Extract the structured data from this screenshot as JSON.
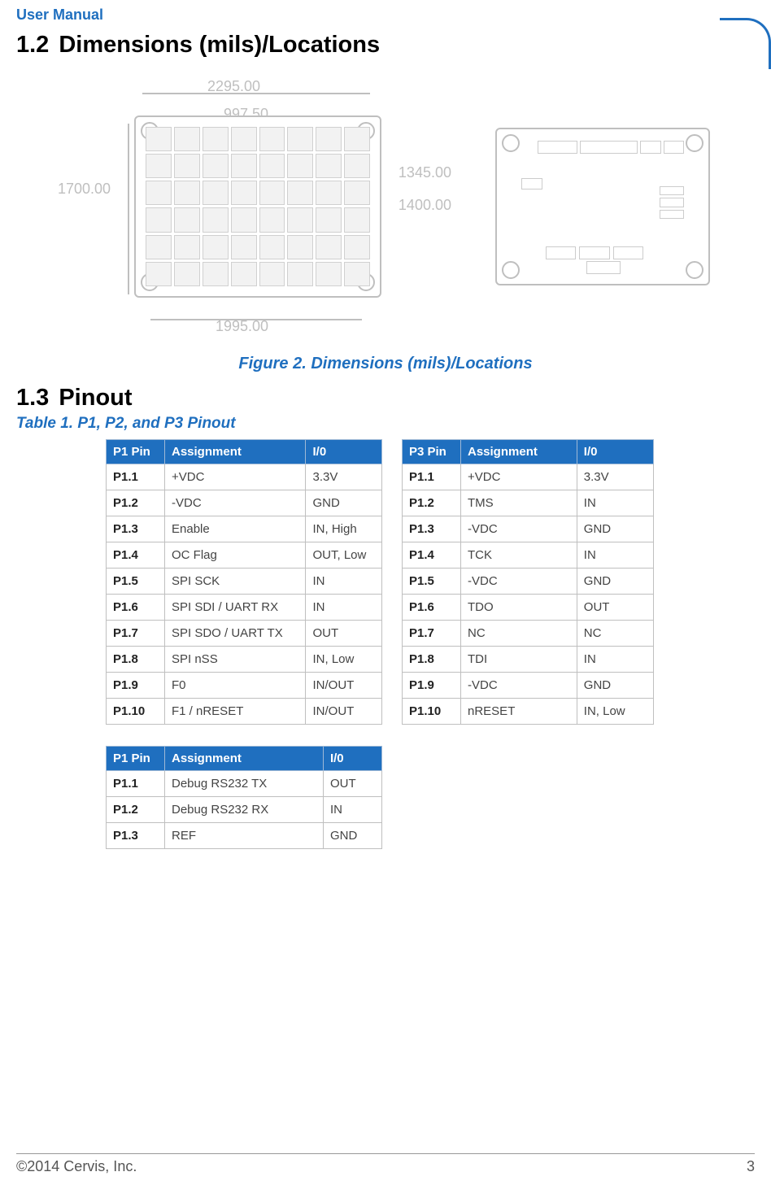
{
  "header": {
    "title": "User Manual"
  },
  "sections": {
    "dimensions": {
      "number": "1.2",
      "title": "Dimensions (mils)/Locations"
    },
    "pinout": {
      "number": "1.3",
      "title": "Pinout"
    }
  },
  "figure": {
    "caption": "Figure 2. Dimensions (mils)/Locations",
    "dims": {
      "top_width": "2295.00",
      "top_half": "997.50",
      "left_height": "1700.00",
      "right_inner": "1345.00",
      "right_outer": "1400.00",
      "bottom_width": "1995.00"
    }
  },
  "table_title": "Table 1. P1, P2, and P3 Pinout",
  "tables": {
    "p1": {
      "headers": [
        "P1 Pin",
        "Assignment",
        "I/0"
      ],
      "rows": [
        [
          "P1.1",
          "+VDC",
          "3.3V"
        ],
        [
          "P1.2",
          "-VDC",
          "GND"
        ],
        [
          "P1.3",
          "Enable",
          "IN, High"
        ],
        [
          "P1.4",
          "OC Flag",
          "OUT, Low"
        ],
        [
          "P1.5",
          "SPI SCK",
          "IN"
        ],
        [
          "P1.6",
          "SPI SDI / UART RX",
          "IN"
        ],
        [
          "P1.7",
          "SPI SDO / UART TX",
          "OUT"
        ],
        [
          "P1.8",
          "SPI nSS",
          "IN, Low"
        ],
        [
          "P1.9",
          "F0",
          "IN/OUT"
        ],
        [
          "P1.10",
          "F1 / nRESET",
          "IN/OUT"
        ]
      ]
    },
    "p3": {
      "headers": [
        "P3 Pin",
        "Assignment",
        "I/0"
      ],
      "rows": [
        [
          "P1.1",
          "+VDC",
          "3.3V"
        ],
        [
          "P1.2",
          "TMS",
          "IN"
        ],
        [
          "P1.3",
          "-VDC",
          "GND"
        ],
        [
          "P1.4",
          "TCK",
          "IN"
        ],
        [
          "P1.5",
          "-VDC",
          "GND"
        ],
        [
          "P1.6",
          "TDO",
          "OUT"
        ],
        [
          "P1.7",
          "NC",
          "NC"
        ],
        [
          "P1.8",
          "TDI",
          "IN"
        ],
        [
          "P1.9",
          "-VDC",
          "GND"
        ],
        [
          "P1.10",
          "nRESET",
          "IN, Low"
        ]
      ]
    },
    "p2": {
      "headers": [
        "P1 Pin",
        "Assignment",
        "I/0"
      ],
      "rows": [
        [
          "P1.1",
          "Debug RS232 TX",
          "OUT"
        ],
        [
          "P1.2",
          "Debug RS232 RX",
          "IN"
        ],
        [
          "P1.3",
          "REF",
          "GND"
        ]
      ]
    }
  },
  "footer": {
    "copyright": "©2014 Cervis, Inc.",
    "page": "3"
  }
}
